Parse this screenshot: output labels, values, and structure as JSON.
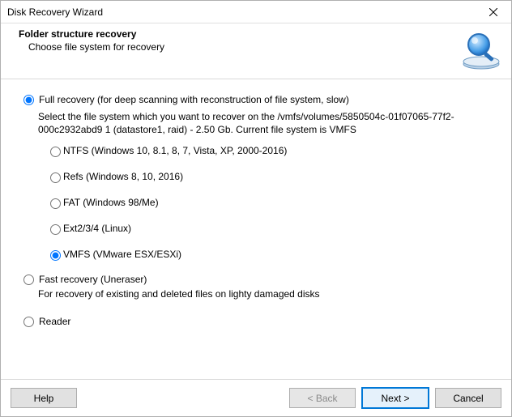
{
  "window": {
    "title": "Disk Recovery Wizard"
  },
  "header": {
    "title": "Folder structure recovery",
    "subtitle": "Choose file system for recovery"
  },
  "modes": {
    "full": {
      "label": "Full recovery (for deep scanning with reconstruction of file system, slow)",
      "desc": "Select the file system which you want to recover on the /vmfs/volumes/5850504c-01f07065-77f2-000c2932abd9 1 (datastore1, raid) - 2.50 Gb. Current file system is VMFS"
    },
    "fast": {
      "label": "Fast recovery (Uneraser)",
      "desc": "For recovery of existing and deleted files on lighty damaged disks"
    },
    "reader": {
      "label": "Reader"
    },
    "selected": "full"
  },
  "filesystems": {
    "options": [
      {
        "id": "ntfs",
        "label": "NTFS (Windows 10, 8.1, 8, 7, Vista, XP, 2000-2016)"
      },
      {
        "id": "refs",
        "label": "Refs (Windows 8, 10, 2016)"
      },
      {
        "id": "fat",
        "label": "FAT (Windows 98/Me)"
      },
      {
        "id": "ext",
        "label": "Ext2/3/4 (Linux)"
      },
      {
        "id": "vmfs",
        "label": "VMFS (VMware ESX/ESXi)"
      }
    ],
    "selected": "vmfs"
  },
  "buttons": {
    "help": "Help",
    "back": "< Back",
    "next": "Next >",
    "cancel": "Cancel"
  }
}
